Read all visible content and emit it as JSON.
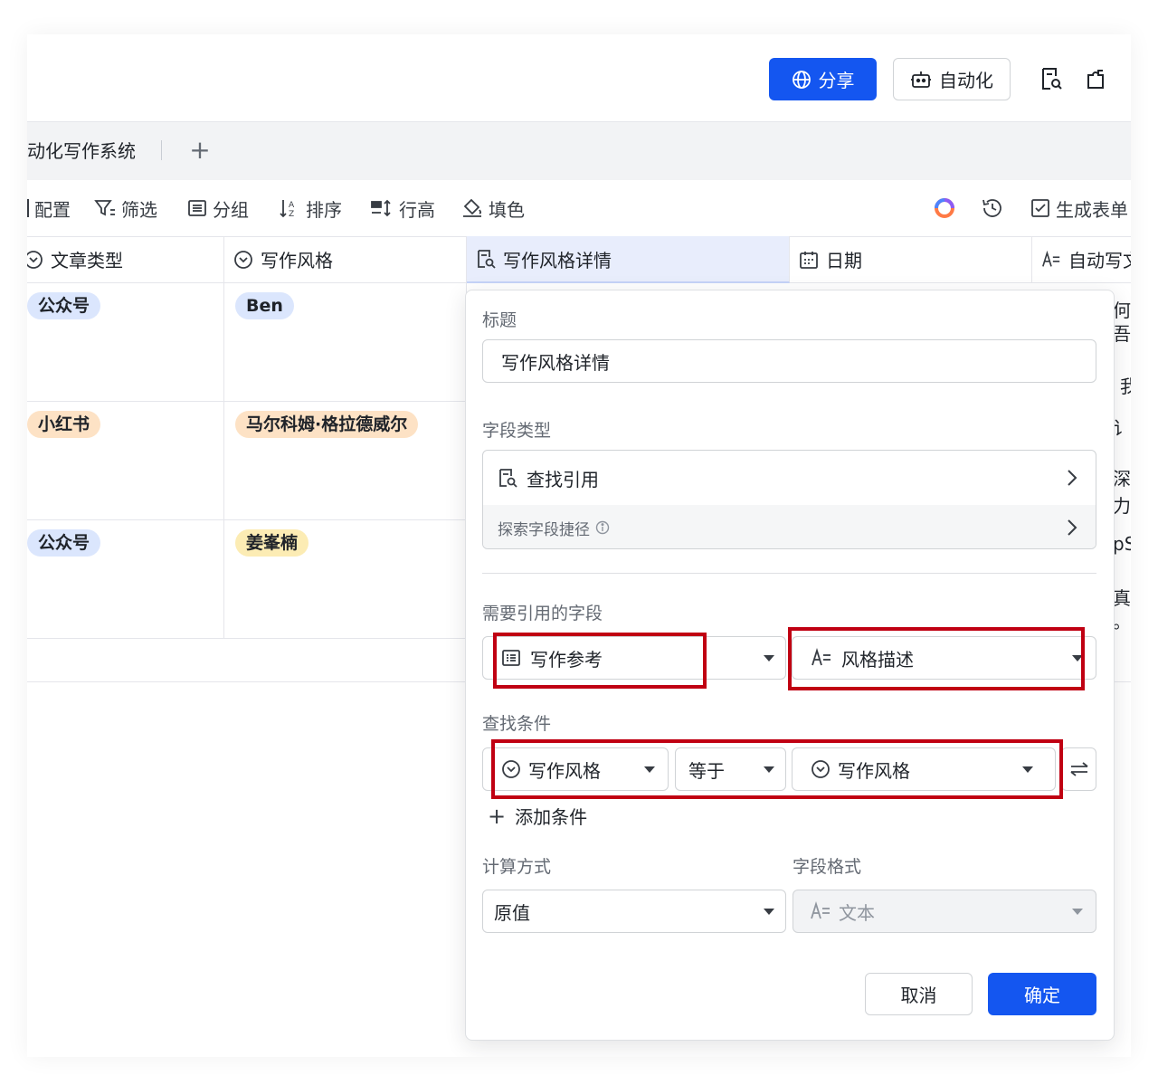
{
  "topbar": {
    "share_label": "分享",
    "automation_label": "自动化",
    "share_color": "#1456f0"
  },
  "tabs": {
    "active_label": "动化写作系统",
    "add_symbol": "+"
  },
  "toolbar": {
    "config_label": "配置",
    "filter_label": "筛选",
    "group_label": "分组",
    "sort_label": "排序",
    "row_height_label": "行高",
    "fill_label": "填色",
    "generate_form_label": "生成表单"
  },
  "grid": {
    "columns": [
      {
        "label": "文章类型",
        "icon": "single-select-icon"
      },
      {
        "label": "写作风格",
        "icon": "single-select-icon"
      },
      {
        "label": "写作风格详情",
        "icon": "lookup-icon"
      },
      {
        "label": "日期",
        "icon": "calendar-icon"
      },
      {
        "label": "自动写文",
        "icon": "text-ai-icon"
      }
    ],
    "rows": [
      {
        "type": "公众号",
        "style": "Ben"
      },
      {
        "type": "小红书",
        "style": "马尔科姆·格拉德威尔"
      },
      {
        "type": "公众号",
        "style": "姜峯楠"
      }
    ],
    "edge_fragments": [
      "何",
      "吾",
      "我",
      "讠",
      "深",
      "力",
      "pS",
      "真",
      "。"
    ]
  },
  "dialog": {
    "title_label": "标题",
    "title_value": "写作风格详情",
    "field_type_label": "字段类型",
    "field_type_value": "查找引用",
    "explore_shortcut": "探索字段捷径",
    "ref_fields_label": "需要引用的字段",
    "ref_table": "写作参考",
    "ref_field": "风格描述",
    "condition_label": "查找条件",
    "cond_field": "写作风格",
    "cond_operator": "等于",
    "cond_value": "写作风格",
    "add_condition": "添加条件",
    "calc_label": "计算方式",
    "calc_value": "原值",
    "format_label": "字段格式",
    "format_value": "文本",
    "cancel_label": "取消",
    "confirm_label": "确定",
    "highlight_color": "#c00012"
  }
}
